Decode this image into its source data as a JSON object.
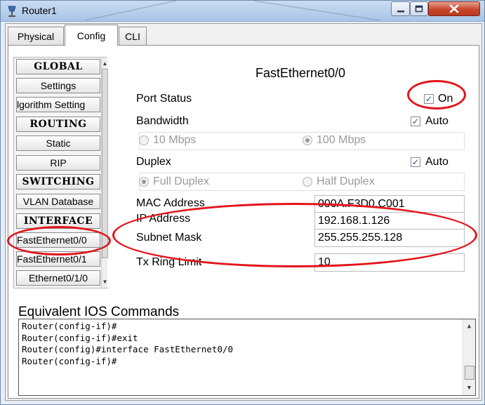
{
  "window": {
    "title": "Router1"
  },
  "tabs": [
    {
      "label": "Physical"
    },
    {
      "label": "Config"
    },
    {
      "label": "CLI"
    }
  ],
  "sidebar": {
    "items": [
      {
        "label": "GLOBAL",
        "header": true
      },
      {
        "label": "Settings"
      },
      {
        "label": "lgorithm Setting"
      },
      {
        "label": "ROUTING",
        "header": true
      },
      {
        "label": "Static"
      },
      {
        "label": "RIP"
      },
      {
        "label": "SWITCHING",
        "header": true
      },
      {
        "label": "VLAN Database"
      },
      {
        "label": "INTERFACE",
        "header": true
      },
      {
        "label": "FastEthernet0/0"
      },
      {
        "label": "FastEthernet0/1"
      },
      {
        "label": "Ethernet0/1/0"
      }
    ]
  },
  "interface": {
    "title": "FastEthernet0/0",
    "port_status": {
      "label": "Port Status",
      "checkbox_label": "On",
      "checked": true
    },
    "bandwidth": {
      "label": "Bandwidth",
      "auto_label": "Auto",
      "auto_checked": true,
      "options": [
        "10 Mbps",
        "100 Mbps"
      ],
      "selected": "100 Mbps"
    },
    "duplex": {
      "label": "Duplex",
      "auto_label": "Auto",
      "auto_checked": true,
      "options": [
        "Full Duplex",
        "Half Duplex"
      ],
      "selected": "Full Duplex"
    },
    "mac": {
      "label": "MAC Address",
      "value": "000A.F3D0.C001"
    },
    "ip": {
      "label": "IP Address",
      "value": "192.168.1.126"
    },
    "mask": {
      "label": "Subnet Mask",
      "value": "255.255.255.128"
    },
    "tx": {
      "label": "Tx Ring Limit",
      "value": "10"
    }
  },
  "ios": {
    "title": "Equivalent IOS Commands",
    "lines": [
      "Router(config-if)#",
      "Router(config-if)#exit",
      "Router(config)#interface FastEthernet0/0",
      "Router(config-if)#"
    ]
  },
  "colors": {
    "annotation": "#e3141b",
    "titlebar": "#b9d1ee",
    "close": "#c7462b"
  }
}
